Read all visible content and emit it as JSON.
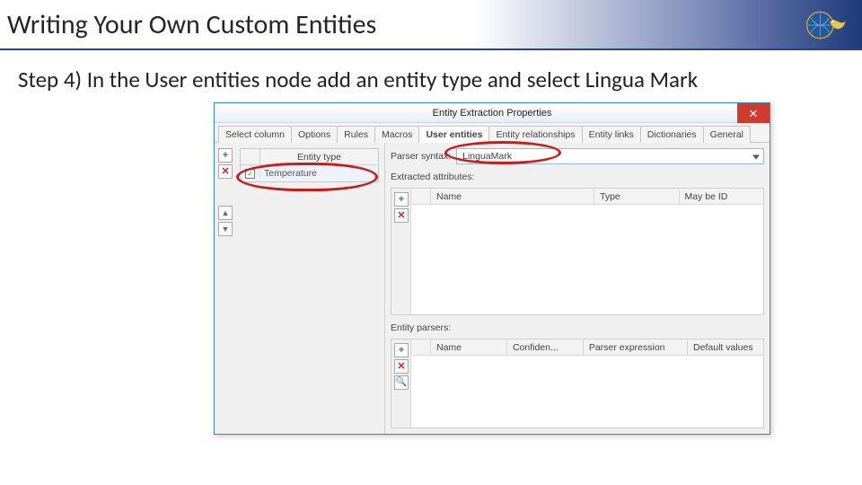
{
  "slide": {
    "title": "Writing Your Own Custom Entities",
    "step_text": "Step 4) In the User entities node add an entity type and select Lingua Mark"
  },
  "dialog": {
    "title": "Entity Extraction Properties",
    "close_glyph": "✕",
    "tabs": [
      {
        "label": "Select column",
        "active": false
      },
      {
        "label": "Options",
        "active": false
      },
      {
        "label": "Rules",
        "active": false
      },
      {
        "label": "Macros",
        "active": false
      },
      {
        "label": "User entities",
        "active": true
      },
      {
        "label": "Entity relationships",
        "active": false
      },
      {
        "label": "Entity links",
        "active": false
      },
      {
        "label": "Dictionaries",
        "active": false
      },
      {
        "label": "General",
        "active": false
      }
    ],
    "left": {
      "entity_type_header": "Entity type",
      "rows": [
        {
          "checked": true,
          "name": "Temperature"
        }
      ],
      "icons": {
        "plus": "+",
        "remove": "✕",
        "up": "▲",
        "down": "▼"
      }
    },
    "right": {
      "parser_label": "Parser syntax:",
      "parser_value": "LinguaMark",
      "extracted_label": "Extracted attributes:",
      "attr_columns": {
        "name": "Name",
        "type": "Type",
        "maybe_id": "May be ID"
      },
      "entity_parsers_label": "Entity parsers:",
      "parser_columns": {
        "name": "Name",
        "confidence": "Confiden...",
        "expression": "Parser expression",
        "defaults": "Default values"
      },
      "icons": {
        "plus": "+",
        "remove": "✕",
        "magnify": "🔍"
      }
    }
  }
}
